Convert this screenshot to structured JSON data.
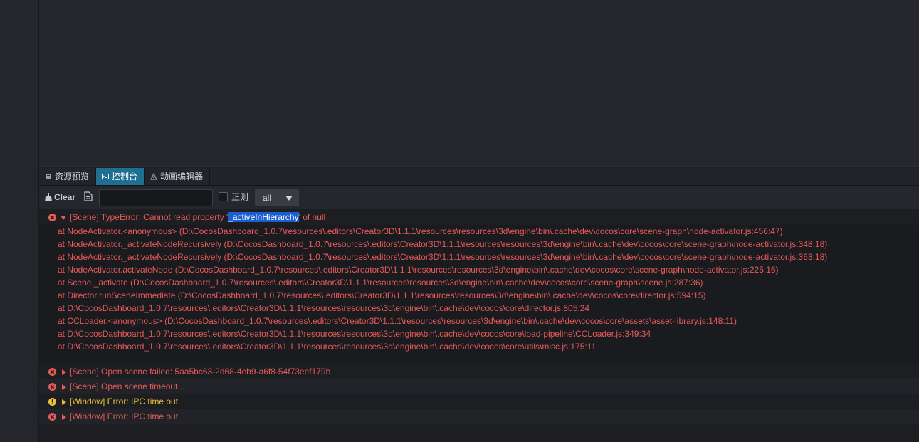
{
  "tabs": [
    {
      "label": "资源预览",
      "icon": "asset-preview-icon"
    },
    {
      "label": "控制台",
      "icon": "console-icon",
      "active": true
    },
    {
      "label": "动画编辑器",
      "icon": "animation-editor-icon"
    }
  ],
  "toolbar": {
    "clear_label": "Clear",
    "search_value": "",
    "search_placeholder": "",
    "regex_label": "正则",
    "regex_checked": false,
    "level_value": "all"
  },
  "log": {
    "entry1": {
      "level": "error",
      "expanded": true,
      "pre": "[Scene] TypeError: Cannot read property '",
      "highlight": "_activeInHierarchy",
      "post": "' of null",
      "stack": [
        "at NodeActivator.<anonymous> (D:\\CocosDashboard_1.0.7\\resources\\.editors\\Creator3D\\1.1.1\\resources\\resources\\3d\\engine\\bin\\.cache\\dev\\cocos\\core\\scene-graph\\node-activator.js:456:47)",
        "at NodeActivator._activateNodeRecursively (D:\\CocosDashboard_1.0.7\\resources\\.editors\\Creator3D\\1.1.1\\resources\\resources\\3d\\engine\\bin\\.cache\\dev\\cocos\\core\\scene-graph\\node-activator.js:348:18)",
        "at NodeActivator._activateNodeRecursively (D:\\CocosDashboard_1.0.7\\resources\\.editors\\Creator3D\\1.1.1\\resources\\resources\\3d\\engine\\bin\\.cache\\dev\\cocos\\core\\scene-graph\\node-activator.js:363:18)",
        "at NodeActivator.activateNode (D:\\CocosDashboard_1.0.7\\resources\\.editors\\Creator3D\\1.1.1\\resources\\resources\\3d\\engine\\bin\\.cache\\dev\\cocos\\core\\scene-graph\\node-activator.js:225:16)",
        "at Scene._activate (D:\\CocosDashboard_1.0.7\\resources\\.editors\\Creator3D\\1.1.1\\resources\\resources\\3d\\engine\\bin\\.cache\\dev\\cocos\\core\\scene-graph\\scene.js:287:36)",
        "at Director.runSceneImmediate (D:\\CocosDashboard_1.0.7\\resources\\.editors\\Creator3D\\1.1.1\\resources\\resources\\3d\\engine\\bin\\.cache\\dev\\cocos\\core\\director.js:594:15)",
        "at D:\\CocosDashboard_1.0.7\\resources\\.editors\\Creator3D\\1.1.1\\resources\\resources\\3d\\engine\\bin\\.cache\\dev\\cocos\\core\\director.js:805:24",
        "at CCLoader.<anonymous> (D:\\CocosDashboard_1.0.7\\resources\\.editors\\Creator3D\\1.1.1\\resources\\resources\\3d\\engine\\bin\\.cache\\dev\\cocos\\core\\assets\\asset-library.js:148:11)",
        "at D:\\CocosDashboard_1.0.7\\resources\\.editors\\Creator3D\\1.1.1\\resources\\resources\\3d\\engine\\bin\\.cache\\dev\\cocos\\core\\load-pipeline\\CCLoader.js:349:34",
        "at D:\\CocosDashboard_1.0.7\\resources\\.editors\\Creator3D\\1.1.1\\resources\\resources\\3d\\engine\\bin\\.cache\\dev\\cocos\\core\\utils\\misc.js:175:11"
      ]
    },
    "entry2": {
      "level": "error",
      "text": "[Scene] Open scene failed: 5aa5bc63-2d68-4eb9-a6f8-54f73eef179b"
    },
    "entry3": {
      "level": "error",
      "text": "[Scene] Open scene timeout..."
    },
    "entry4": {
      "level": "warning",
      "text": "[Window] Error: IPC time out"
    },
    "entry5": {
      "level": "error",
      "text": "[Window] Error: IPC time out"
    }
  },
  "colors": {
    "error": "#e65a5a",
    "warning": "#e8c23a",
    "active_tab": "#1f6f92",
    "selection": "#1a5fd1"
  }
}
